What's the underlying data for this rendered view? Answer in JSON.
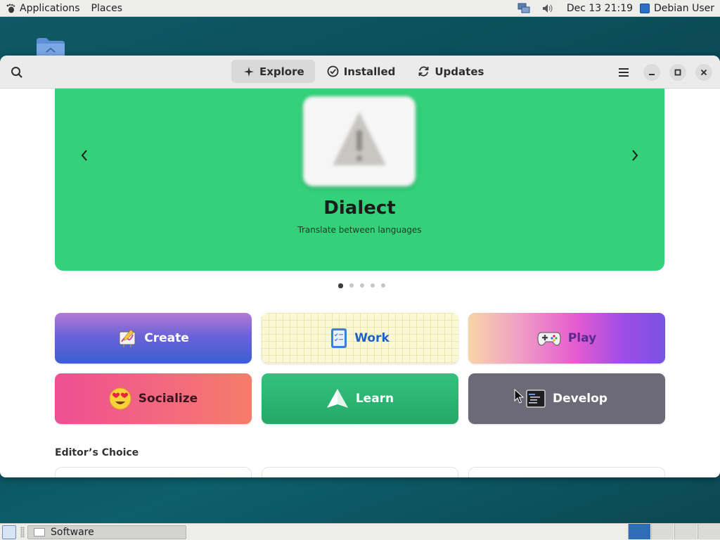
{
  "top_panel": {
    "applications_label": "Applications",
    "places_label": "Places",
    "clock": "Dec 13  21:19",
    "user": "Debian User"
  },
  "window": {
    "tabs": [
      {
        "label": "Explore",
        "icon": "sparkle-icon",
        "active": true
      },
      {
        "label": "Installed",
        "icon": "check-circle-icon",
        "active": false
      },
      {
        "label": "Updates",
        "icon": "refresh-icon",
        "active": false
      }
    ]
  },
  "featured": {
    "app_name": "Dialect",
    "app_description": "Translate between languages",
    "background_color": "#33d17a",
    "page_count": 5,
    "current_page": 1
  },
  "categories": [
    {
      "label": "Create",
      "icon": "create-icon"
    },
    {
      "label": "Work",
      "icon": "work-icon"
    },
    {
      "label": "Play",
      "icon": "gamepad-icon"
    },
    {
      "label": "Socialize",
      "icon": "heart-eyes-emoji-icon"
    },
    {
      "label": "Learn",
      "icon": "learn-icon"
    },
    {
      "label": "Develop",
      "icon": "terminal-icon"
    }
  ],
  "editors_choice": {
    "heading": "Editor’s Choice"
  },
  "bottom_panel": {
    "task_label": "Software",
    "workspace_count": 4,
    "active_workspace": 1
  }
}
